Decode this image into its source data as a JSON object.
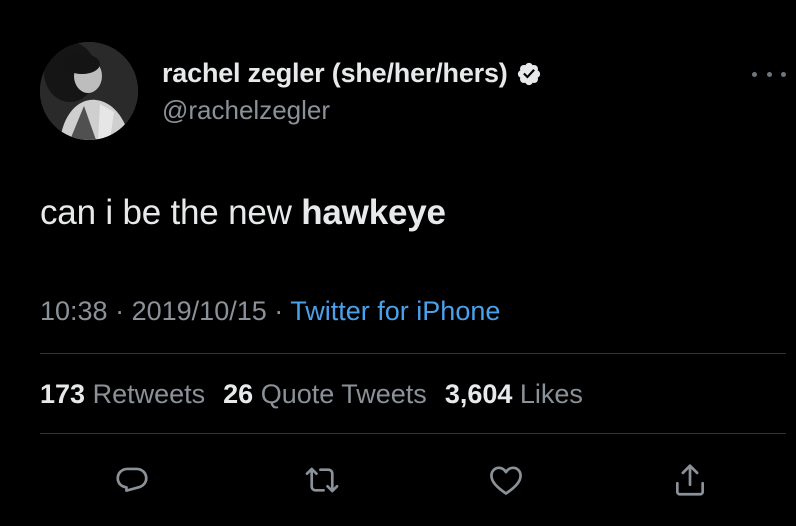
{
  "tweet": {
    "author_name": "rachel zegler (she/her/hers)",
    "author_handle": "@rachelzegler",
    "text_plain": "can i be the new ",
    "text_bold": "hawkeye",
    "time": "10:38",
    "separator": "·",
    "date": "2019/10/15",
    "source": "Twitter for iPhone"
  },
  "stats": {
    "retweets_count": "173",
    "retweets_label": "Retweets",
    "quotes_count": "26",
    "quotes_label": "Quote Tweets",
    "likes_count": "3,604",
    "likes_label": "Likes"
  },
  "icons": {
    "verified": "verified-badge-icon",
    "more": "more-options-icon",
    "reply": "reply-icon",
    "retweet": "retweet-icon",
    "like": "heart-icon",
    "share": "share-icon"
  },
  "colors": {
    "background": "#000000",
    "primary_text": "#e7e9ea",
    "secondary_text": "#8b9198",
    "link": "#4aa1eb",
    "divider": "#2f3336"
  }
}
